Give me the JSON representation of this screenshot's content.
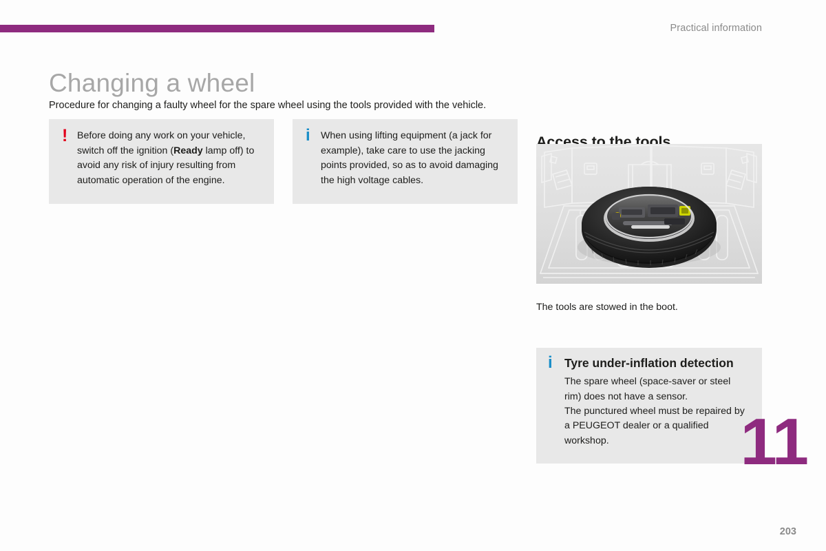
{
  "header": {
    "section_label": "Practical information",
    "accent_color": "#8e2b7f"
  },
  "title": {
    "main": "Changing a wheel",
    "intro": "Procedure for changing a faulty wheel for the spare wheel using the tools provided with the vehicle."
  },
  "callouts": {
    "warning": {
      "icon": "warning-exclamation-icon",
      "icon_glyph": "!",
      "icon_color": "#e2001a",
      "text_before_bold": "Before doing any work on your vehicle, switch off the ignition (",
      "bold_word": "Ready",
      "text_after_bold": " lamp off) to avoid any risk of injury resulting from automatic operation of the engine."
    },
    "jacking": {
      "icon": "information-icon",
      "icon_glyph": "i",
      "icon_color": "#1a8ec8",
      "text": "When using lifting equipment (a jack for example), take care to use the jacking points provided, so as to avoid damaging the high voltage cables."
    },
    "tyre": {
      "icon": "information-icon",
      "icon_glyph": "i",
      "icon_color": "#1a8ec8",
      "heading": "Tyre under-inflation detection",
      "body_line_1": "The spare wheel (space-saver or steel rim) does not have a sensor.",
      "body_line_2": "The punctured wheel must be repaired by a PEUGEOT dealer or a qualified workshop."
    }
  },
  "tools_section": {
    "heading": "Access to the tools",
    "figure_alt": "boot-with-spare-wheel-illustration",
    "caption": "The tools are stowed in the boot."
  },
  "footer": {
    "chapter_number": "11",
    "page_number": "203",
    "chapter_color": "#8e2b7f"
  }
}
